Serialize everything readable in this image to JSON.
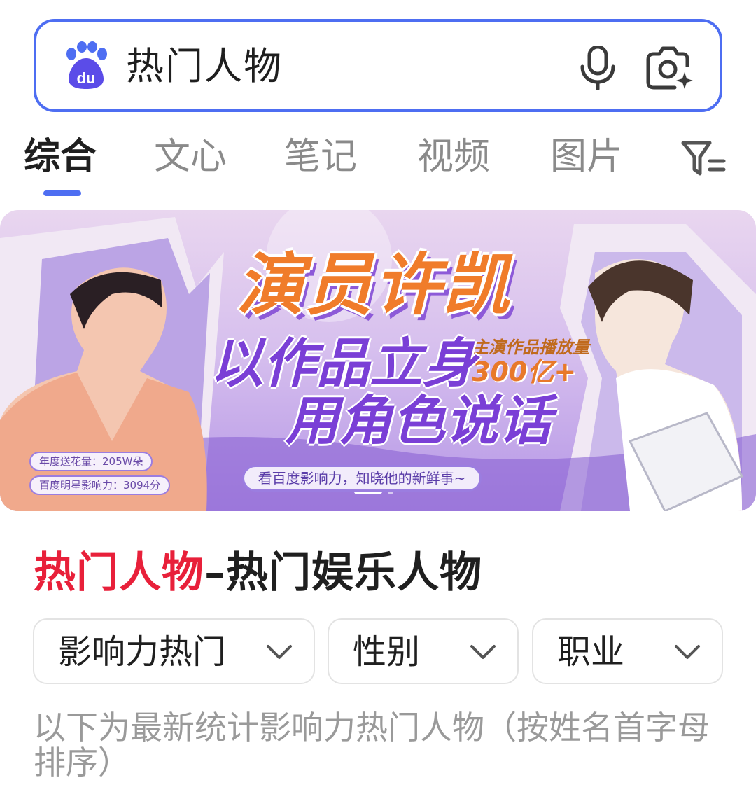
{
  "search": {
    "query": "热门人物",
    "logo_icon": "baidu-paw-logo",
    "logo_text": "du",
    "mic_icon": "microphone-icon",
    "camera_icon": "camera-search-icon",
    "border_color": "#4e6ef2"
  },
  "tabs": {
    "items": [
      {
        "label": "综合",
        "active": true
      },
      {
        "label": "文心",
        "active": false
      },
      {
        "label": "笔记",
        "active": false
      },
      {
        "label": "视频",
        "active": false
      },
      {
        "label": "图片",
        "active": false
      }
    ],
    "filter_icon": "funnel-filter-icon",
    "accent": "#4e6ef2"
  },
  "banner": {
    "title": "演员许凯",
    "slogan_line1": "以作品立身",
    "slogan_line2": "用角色说话",
    "badge_label": "主演作品播放量",
    "badge_value": "300亿+",
    "cta": "看百度影响力，知晓他的新鲜事~",
    "stat_flowers": "年度送花量：205W朵",
    "stat_influence": "百度明星影响力：3094分",
    "slide_count": 2,
    "active_slide": 1
  },
  "result": {
    "title_highlight": "热门人物",
    "title_rest": "–热门娱乐人物",
    "highlight_color": "#e8203a",
    "filters": [
      {
        "label": "影响力热门",
        "icon": "chevron-down-icon"
      },
      {
        "label": "性别",
        "icon": "chevron-down-icon"
      },
      {
        "label": "职业",
        "icon": "chevron-down-icon"
      }
    ],
    "description": "以下为最新统计影响力热门人物（按姓名首字母排序）"
  }
}
